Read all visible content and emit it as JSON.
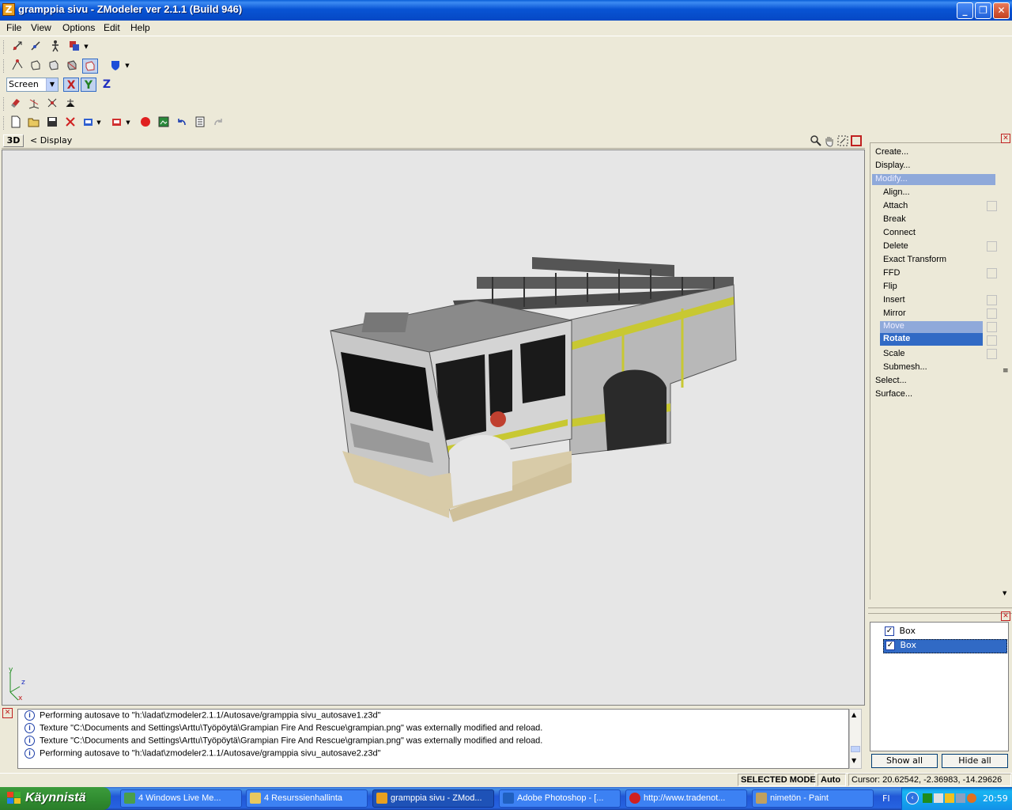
{
  "window": {
    "title": "gramppia sivu - ZModeler ver 2.1.1 (Build 946)",
    "app_icon": "Z"
  },
  "menu": [
    "File",
    "View",
    "Options",
    "Edit",
    "Help"
  ],
  "toolbar": {
    "coord_system": "Screen",
    "axes": [
      "X",
      "Y",
      "Z"
    ]
  },
  "viewport": {
    "mode_label": "3D",
    "display_label": "<  Display",
    "axis_y": "y",
    "axis_z": "z",
    "axis_x": "x"
  },
  "commands": {
    "items": [
      "Create...",
      "Display...",
      "Modify...",
      "Align...",
      "Attach",
      "Break",
      "Connect",
      "Delete",
      "Exact Transform",
      "FFD",
      "Flip",
      "Insert",
      "Mirror",
      "Move",
      "Rotate",
      "Scale",
      "Submesh...",
      "Select...",
      "Surface..."
    ],
    "highlighted": "Modify...",
    "selected": "Rotate"
  },
  "layers": {
    "items": [
      {
        "label": "Box",
        "checked": true
      },
      {
        "label": "Box",
        "checked": true
      }
    ],
    "show_all": "Show all",
    "hide_all": "Hide all"
  },
  "log": [
    "Performing autosave to \"h:\\ladat\\zmodeler2.1.1/Autosave/gramppia sivu_autosave1.z3d\"",
    "Texture \"C:\\Documents and Settings\\Arttu\\Työpöytä\\Grampian Fire And Rescue\\grampian.png\" was externally modified and reload.",
    "Texture \"C:\\Documents and Settings\\Arttu\\Työpöytä\\Grampian Fire And Rescue\\grampian.png\" was externally modified and reload.",
    "Performing autosave to \"h:\\ladat\\zmodeler2.1.1/Autosave/gramppia sivu_autosave2.z3d\""
  ],
  "status": {
    "mode": "SELECTED MODE",
    "auto": "Auto",
    "cursor": "Cursor: 20.62542, -2.36983, -14.29626"
  },
  "taskbar": {
    "start": "Käynnistä",
    "tasks": [
      "4 Windows Live Me...",
      "4 Resurssienhallinta",
      "gramppia sivu - ZMod...",
      "Adobe Photoshop - [...",
      "http://www.tradenot...",
      "nimetön - Paint"
    ],
    "active_task": "gramppia sivu - ZMod...",
    "lang": "FI",
    "clock": "20:59"
  },
  "colors": {
    "title_blue": "#0854d4",
    "highlight": "#316ac5",
    "viewport_bg": "#e6e6e6",
    "truck_yellow": "#c8c832"
  }
}
